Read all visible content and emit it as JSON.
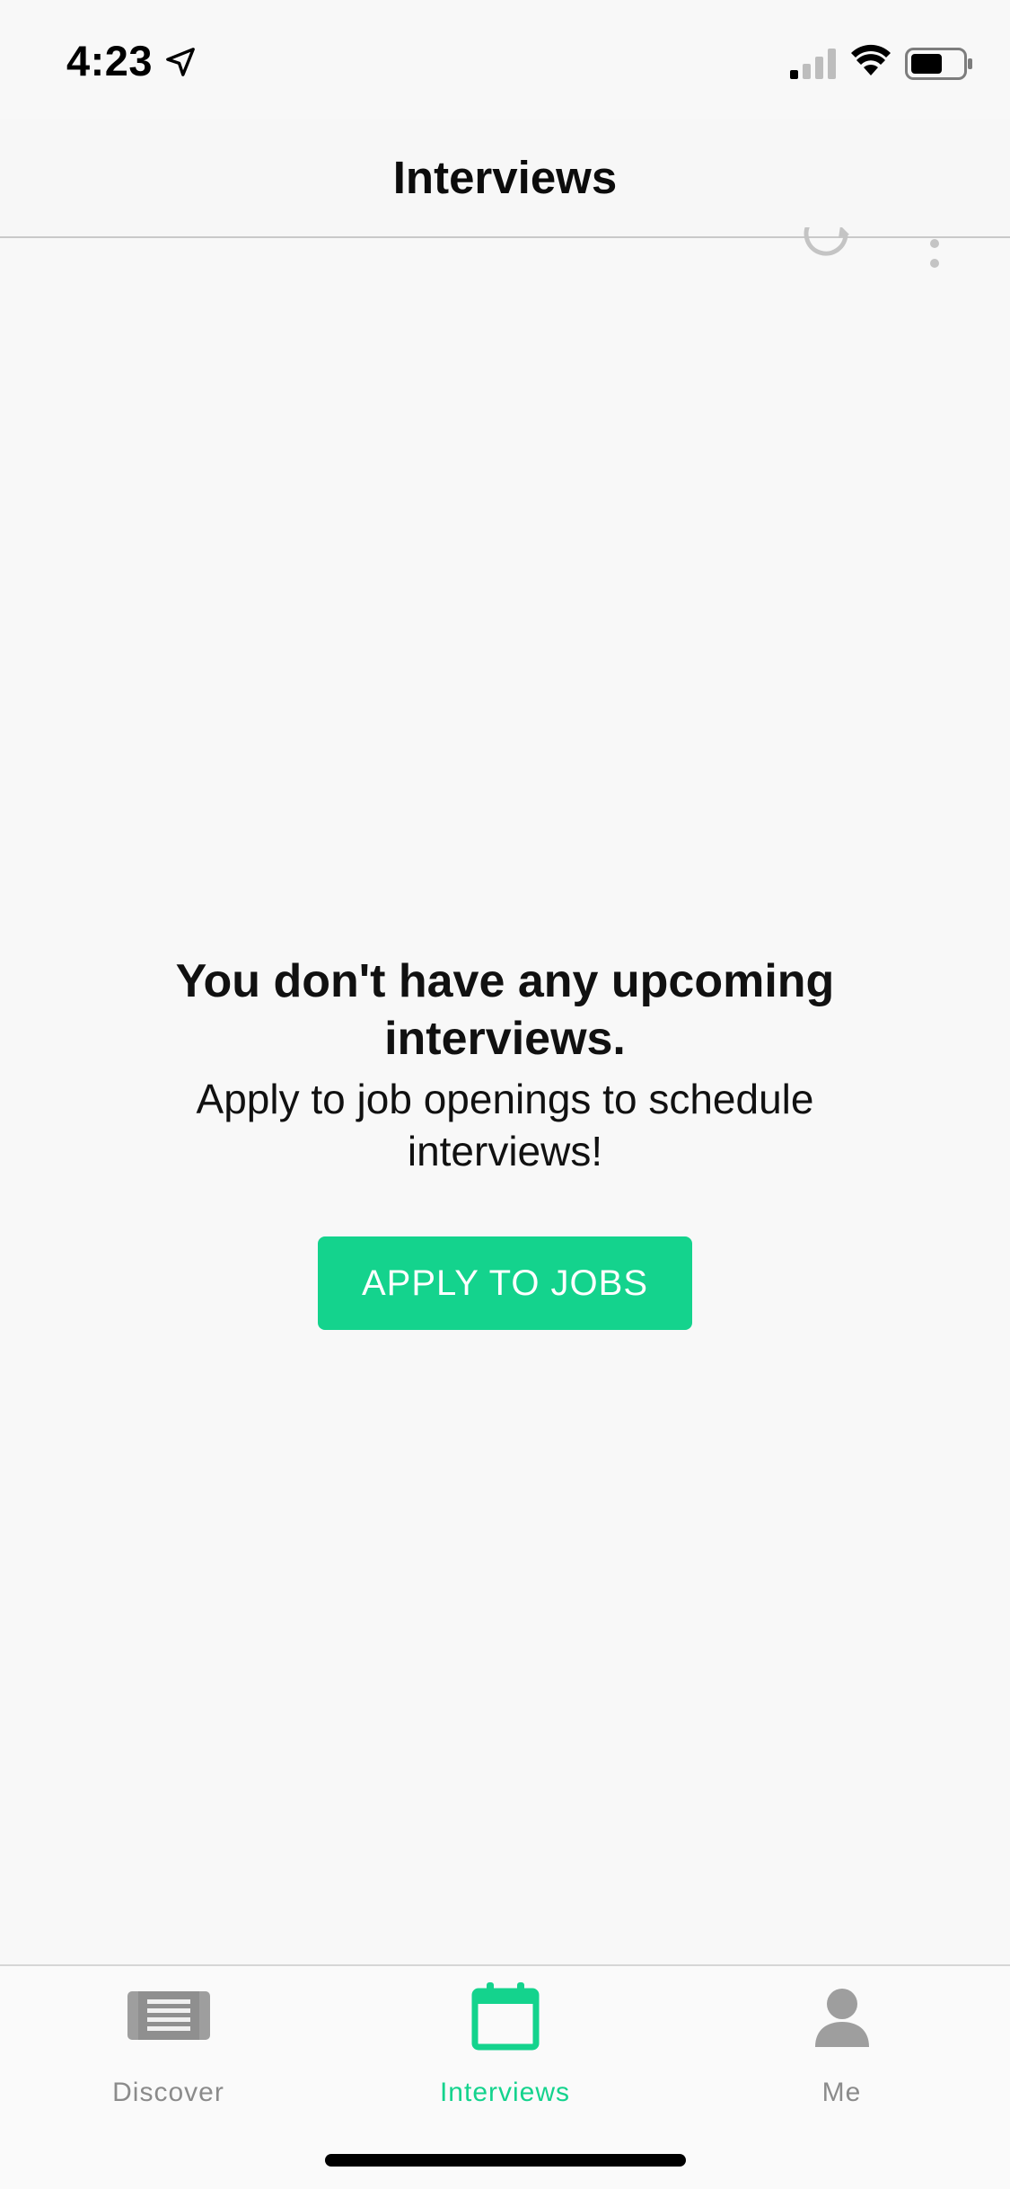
{
  "status_bar": {
    "time": "4:23"
  },
  "nav": {
    "title": "Interviews"
  },
  "toolbar": {
    "refresh_icon": "refresh-icon",
    "more_icon": "more-vertical-icon"
  },
  "empty_state": {
    "title": "You don't have any upcoming interviews.",
    "subtitle": "Apply to job openings to schedule interviews!",
    "button_label": "APPLY TO JOBS"
  },
  "tabs": [
    {
      "label": "Discover",
      "icon": "newspaper-icon",
      "active": false
    },
    {
      "label": "Interviews",
      "icon": "calendar-icon",
      "active": true
    },
    {
      "label": "Me",
      "icon": "person-icon",
      "active": false
    }
  ],
  "colors": {
    "accent": "#14d38d",
    "inactive_tab": "#8b8b8b",
    "background": "#f8f8f8"
  }
}
